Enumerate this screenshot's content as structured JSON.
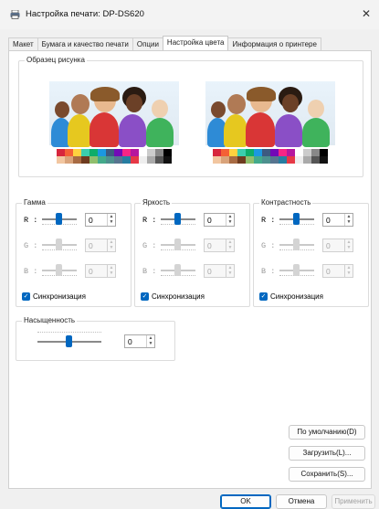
{
  "window": {
    "title": "Настройка печати: DP-DS620",
    "close_glyph": "✕"
  },
  "tabs": [
    {
      "label": "Макет"
    },
    {
      "label": "Бумага и качество печати"
    },
    {
      "label": "Опции"
    },
    {
      "label": "Настройка цвета",
      "active": true
    },
    {
      "label": "Информация о принтере"
    }
  ],
  "sample": {
    "legend": "Образец рисунка"
  },
  "groups": {
    "gamma": {
      "legend": "Гамма",
      "rows": [
        {
          "label": "R :",
          "value": "0",
          "enabled": true
        },
        {
          "label": "G :",
          "value": "0",
          "enabled": false
        },
        {
          "label": "B :",
          "value": "0",
          "enabled": false
        }
      ],
      "sync_label": "Синхронизация",
      "sync_checked": true
    },
    "brightness": {
      "legend": "Яркость",
      "rows": [
        {
          "label": "R :",
          "value": "0",
          "enabled": true
        },
        {
          "label": "G :",
          "value": "0",
          "enabled": false
        },
        {
          "label": "B :",
          "value": "0",
          "enabled": false
        }
      ],
      "sync_label": "Синхронизация",
      "sync_checked": true
    },
    "contrast": {
      "legend": "Контрастность",
      "rows": [
        {
          "label": "R :",
          "value": "0",
          "enabled": true
        },
        {
          "label": "G :",
          "value": "0",
          "enabled": false
        },
        {
          "label": "B :",
          "value": "0",
          "enabled": false
        }
      ],
      "sync_label": "Синхронизация",
      "sync_checked": true
    },
    "saturation": {
      "legend": "Насыщенность",
      "value": "0"
    }
  },
  "side_buttons": {
    "default": "По умолчанию(D)",
    "load": "Загрузить(L)...",
    "save": "Сохранить(S)..."
  },
  "footer": {
    "ok": "OK",
    "cancel": "Отмена",
    "apply": "Применить"
  },
  "colors": {
    "accent": "#0067c0",
    "disabled": "#a0a0a0"
  }
}
